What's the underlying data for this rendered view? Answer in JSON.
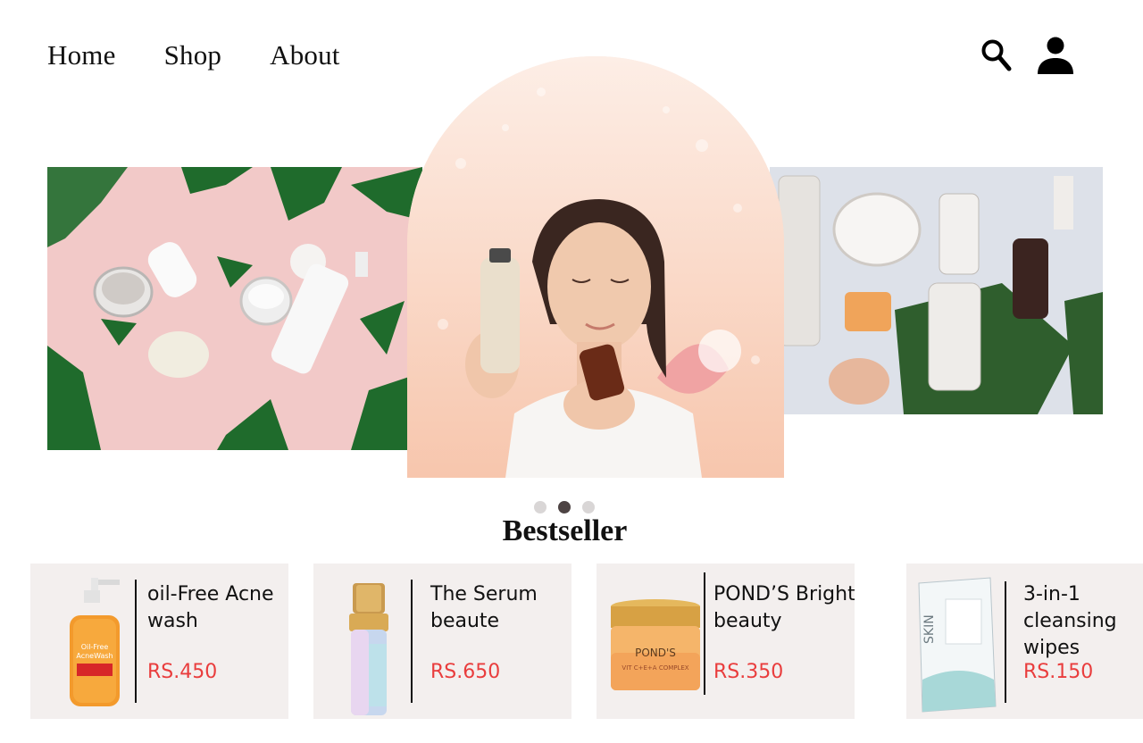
{
  "nav": {
    "items": [
      "Home",
      "Shop",
      "About"
    ],
    "icons": [
      "search-icon",
      "user-icon"
    ]
  },
  "hero": {
    "slides": [
      "skincare-flatlay",
      "model-with-serum",
      "serum-bottles"
    ],
    "active_slide": 2,
    "slide_count": 3
  },
  "section": {
    "title": "Bestseller"
  },
  "products": [
    {
      "name": "oil-Free Acne wash",
      "price": "RS.450"
    },
    {
      "name": "The Serum beaute",
      "price": "RS.650"
    },
    {
      "name": "POND’S Bright beauty",
      "price": "RS.350"
    },
    {
      "name": "3-in-1 cleansing wipes",
      "price": "RS.150"
    }
  ],
  "colors": {
    "price": "#e93d3d",
    "card_bg": "#f3efee",
    "dot_active": "#4d4343",
    "dot_inactive": "#d9d6d6"
  }
}
